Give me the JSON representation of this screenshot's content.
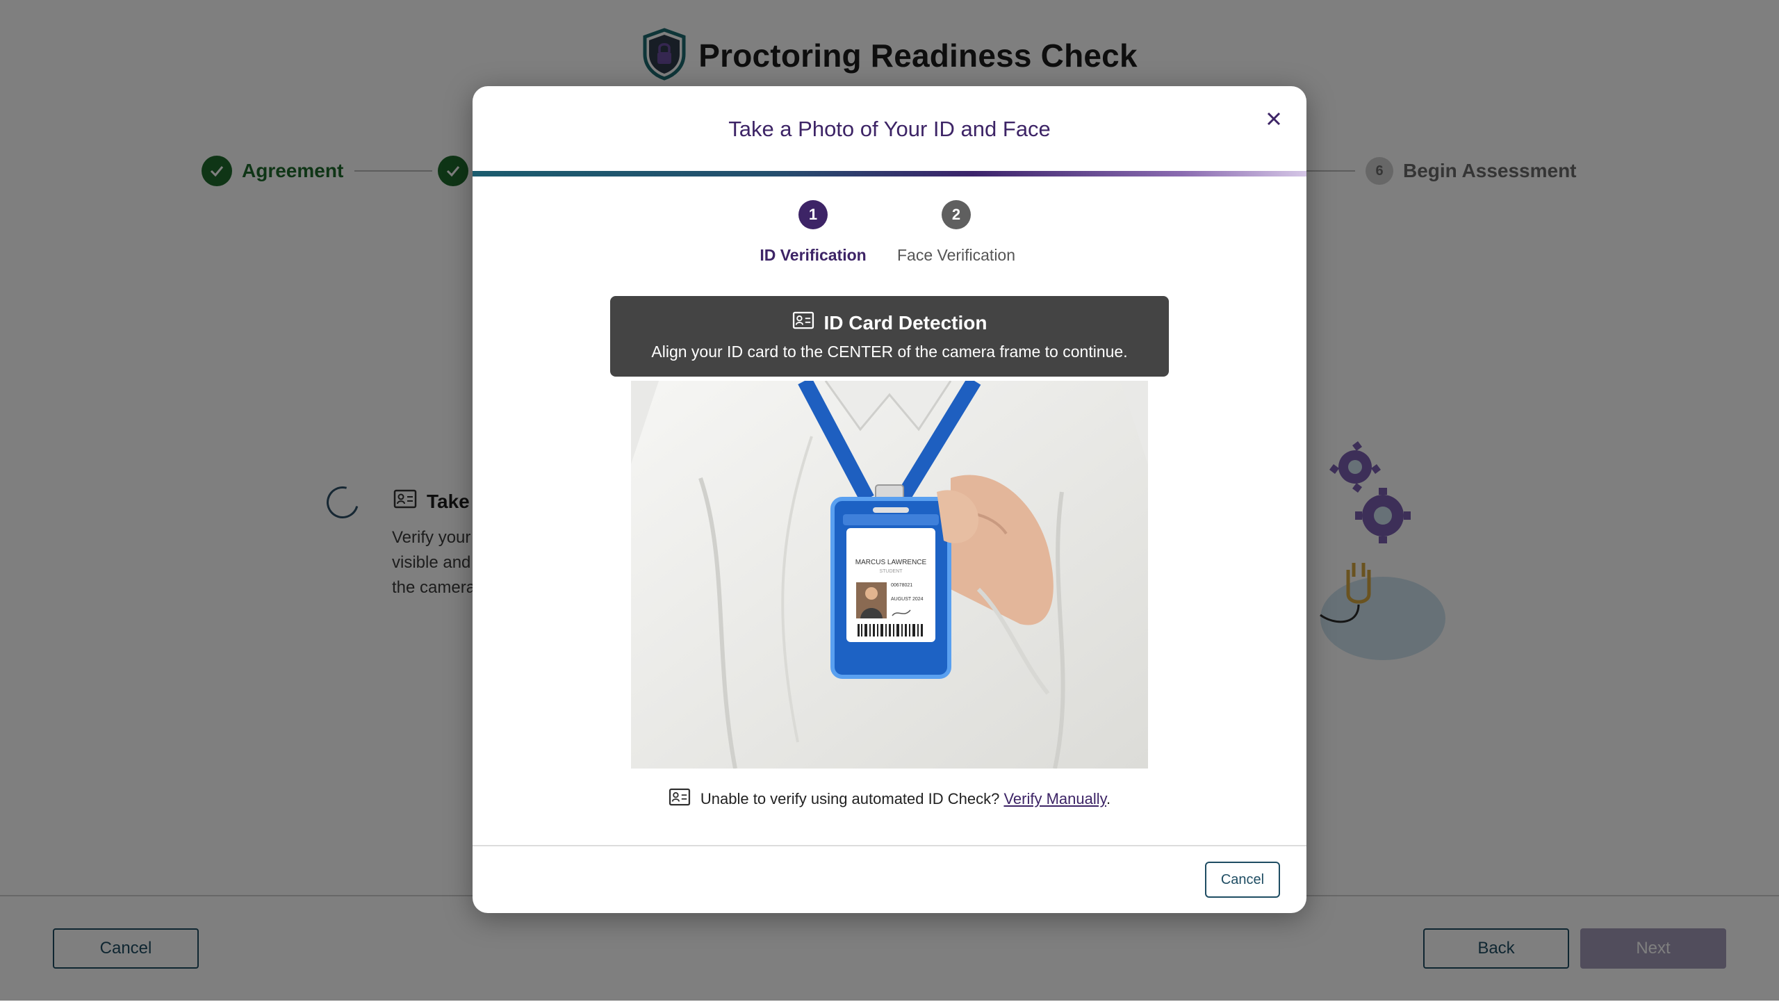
{
  "page": {
    "title": "Proctoring Readiness Check",
    "stepper": [
      {
        "label": "Agreement",
        "state": "done"
      },
      {
        "label": "",
        "state": "done"
      },
      {
        "number": "6",
        "label": "Begin Assessment",
        "state": "todo"
      }
    ],
    "task": {
      "title": "Take",
      "description_lines": [
        "Verify your",
        "visible and",
        "the camera"
      ]
    },
    "footer": {
      "cancel_label": "Cancel",
      "back_label": "Back",
      "next_label": "Next"
    }
  },
  "modal": {
    "title": "Take a Photo of Your ID and Face",
    "close_icon": "close-icon",
    "steps": [
      {
        "number": "1",
        "label": "ID Verification",
        "active": true
      },
      {
        "number": "2",
        "label": "Face Verification",
        "active": false
      }
    ],
    "detection": {
      "title": "ID Card Detection",
      "message": "Align your ID card to the CENTER of the camera frame to continue."
    },
    "badge": {
      "name": "MARCUS LAWRENCE",
      "role": "STUDENT",
      "id_number": "00678021",
      "date": "AUGUST 2024"
    },
    "manual": {
      "text": "Unable to verify using automated ID Check?",
      "link": "Verify Manually",
      "suffix": "."
    },
    "cancel_label": "Cancel"
  },
  "colors": {
    "brand_purple": "#3d2466",
    "brand_teal": "#1f4d63",
    "success_green": "#1e6b2c",
    "badge_blue": "#1d62c4"
  }
}
